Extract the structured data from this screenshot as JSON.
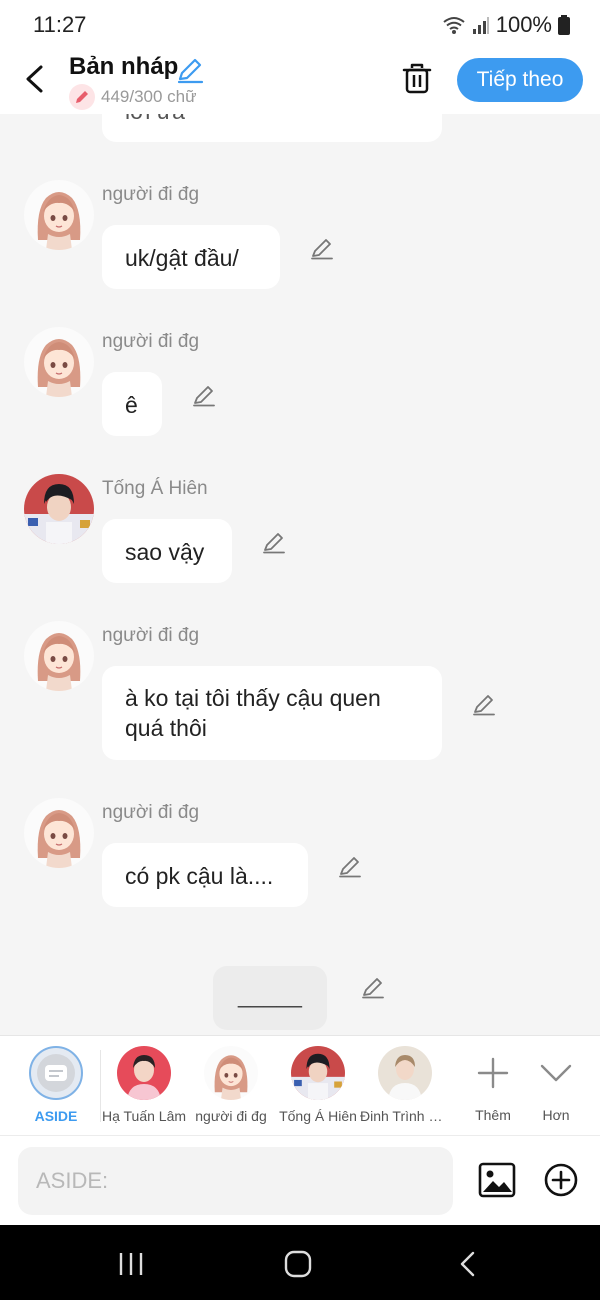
{
  "status_bar": {
    "time": "11:27",
    "battery": "100%"
  },
  "header": {
    "title": "Bản nháp",
    "word_count": "449/300 chữ",
    "next_label": "Tiếp theo"
  },
  "messages": [
    {
      "partial_text": "lời ừa"
    },
    {
      "sender": "người đi đg",
      "text": "uk/gật đầu/"
    },
    {
      "sender": "người đi đg",
      "text": "ê"
    },
    {
      "sender": "Tống Á Hiên",
      "text": "sao vậy"
    },
    {
      "sender": "người đi đg",
      "text": "à ko tại tôi thấy cậu quen quá thôi"
    },
    {
      "sender": "người đi đg",
      "text": "có pk cậu là...."
    },
    {
      "aside_text": "_____"
    }
  ],
  "characters": [
    {
      "name": "ASIDE"
    },
    {
      "name": "Hạ Tuấn Lâm"
    },
    {
      "name": "người đi đg"
    },
    {
      "name": "Tống Á Hiên"
    },
    {
      "name": "Đinh Trình Hâm"
    }
  ],
  "char_actions": {
    "add_label": "Thêm",
    "more_label": "Hơn"
  },
  "composer": {
    "placeholder": "ASIDE:"
  },
  "colors": {
    "accent": "#3d9bf0",
    "background": "#f5f5f5",
    "aside_selected": "#7fb2e6"
  }
}
